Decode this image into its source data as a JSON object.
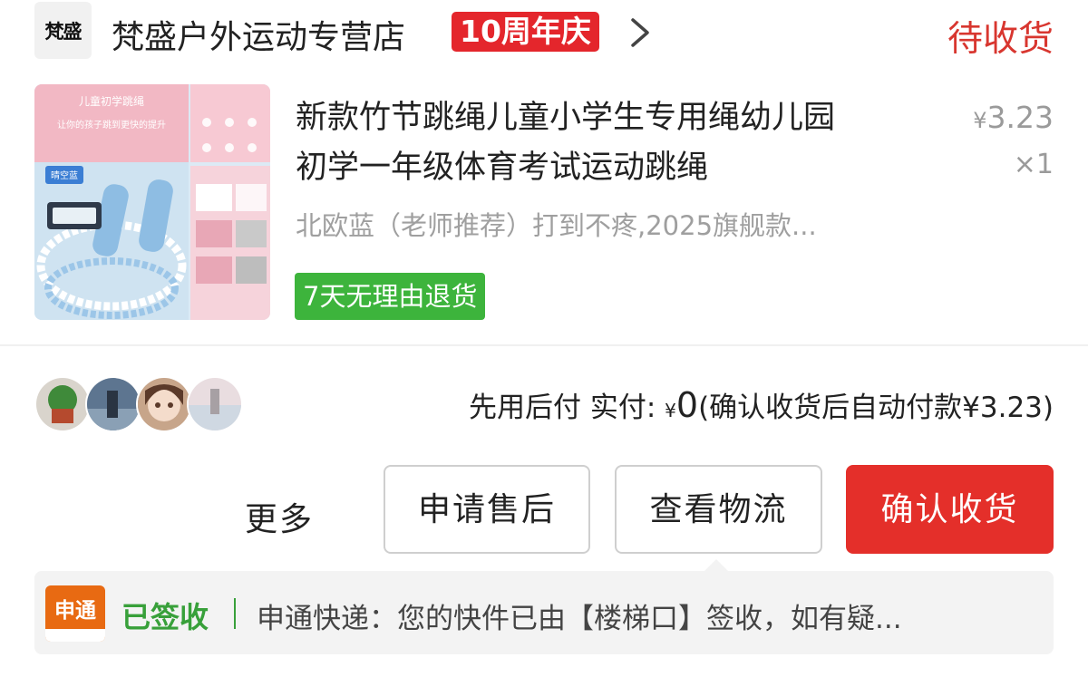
{
  "store": {
    "logo_text": "梵盛",
    "name": "梵盛户外运动专营店",
    "badge": "10周年庆",
    "status": "待收货"
  },
  "product": {
    "title_line1": "新款竹节跳绳儿童小学生专用绳幼儿园",
    "title_line2": "初学一年级体育考试运动跳绳",
    "currency": "¥",
    "price": "3.23",
    "quantity": "×1",
    "spec": "北欧蓝（老师推荐）打到不疼,2025旗舰款...",
    "return_tag": "7天无理由退货",
    "thumbnail": {
      "banner_line1": "儿童初学跳绳",
      "banner_line2": "让你的孩子跳到更快的提升",
      "color_tag": "晴空蓝"
    }
  },
  "payment": {
    "label": "先用后付 实付:",
    "currency": "¥",
    "amount": "0",
    "note": "(确认收货后自动付款¥3.23)"
  },
  "actions": {
    "more": "更多",
    "after_sales": "申请售后",
    "logistics": "查看物流",
    "confirm": "确认收货"
  },
  "logistics": {
    "courier_logo": "申通",
    "status": "已签收",
    "message": "申通快递：您的快件已由【楼梯口】签收，如有疑..."
  },
  "colors": {
    "accent_red": "#e42f2a",
    "green": "#3db43c",
    "courier_orange": "#e86a12"
  }
}
